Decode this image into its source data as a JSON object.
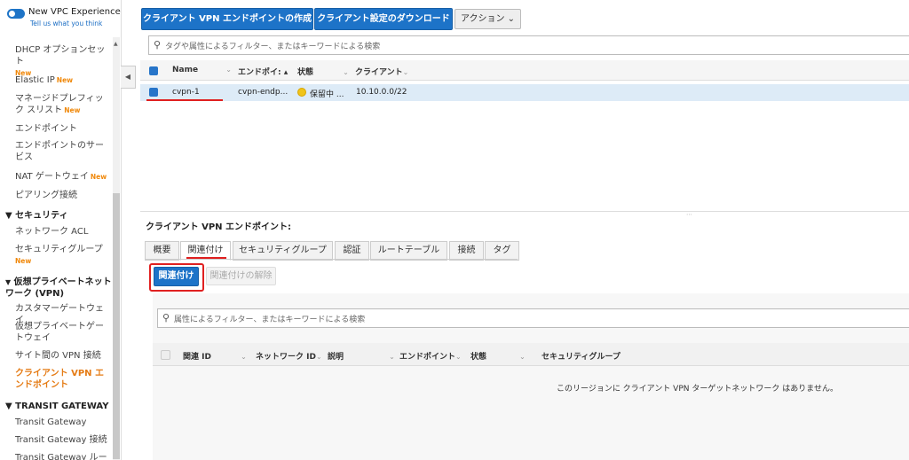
{
  "sidebar": {
    "vpc_experience": "New VPC Experience",
    "tell_us": "Tell us what you think",
    "new_badge": "New",
    "items": [
      {
        "label": "DHCP オプションセット",
        "new": true
      },
      {
        "label": "Elastic IP",
        "new": true
      },
      {
        "label": "マネージドプレフィック スリスト",
        "new": true
      },
      {
        "label": "エンドポイント",
        "new": false
      },
      {
        "label": "エンドポイントのサービス",
        "new": false
      },
      {
        "label": "NAT ゲートウェイ",
        "new": true
      },
      {
        "label": "ピアリング接続",
        "new": false
      }
    ],
    "section_security": "▼ セキュリティ",
    "security_items": [
      "ネットワーク ACL",
      "セキュリティグループ"
    ],
    "section_vpn": "仮想プライベートネットワーク (VPN)",
    "vpn_items": [
      "カスタマーゲートウェイ",
      "仮想プライベートゲートウェイ",
      "サイト間の VPN 接続",
      "クライアント VPN エンドポイント"
    ],
    "section_tgw": "▼ TRANSIT GATEWAY",
    "tgw_items": [
      "Transit Gateway",
      "Transit Gateway 接続",
      "Transit Gateway ルート"
    ]
  },
  "toolbar": {
    "create": "クライアント VPN エンドポイントの作成",
    "download": "クライアント設定のダウンロード",
    "actions": "アクション ⌄"
  },
  "search": {
    "placeholder": "タグや属性によるフィルター、またはキーワードによる検索"
  },
  "table": {
    "headers": [
      "Name",
      "エンドポイ: ▴",
      "状態",
      "クライアント"
    ],
    "rows": [
      {
        "name": "cvpn-1",
        "endpoint": "cvpn-endp...",
        "status": "保留中 ...",
        "client": "10.10.0.0/22"
      }
    ]
  },
  "detail": {
    "title": "クライアント VPN エンドポイント:",
    "tabs": [
      "概要",
      "関連付け",
      "セキュリティグループ",
      "認証",
      "ルートテーブル",
      "接続",
      "タグ"
    ],
    "associate_btn": "関連付け",
    "disassociate_btn": "関連付けの解除",
    "filter_placeholder": "属性によるフィルター、またはキーワードによる検索",
    "headers": [
      "関連 ID",
      "ネットワーク ID",
      "説明",
      "エンドポイント",
      "状態",
      "セキュリティグループ"
    ],
    "empty": "このリージョンに クライアント VPN ターゲットネットワーク はありません。"
  },
  "colors": {
    "primary": "#1d73c8",
    "highlight": "#e02020",
    "new_badge": "#f0880a"
  }
}
